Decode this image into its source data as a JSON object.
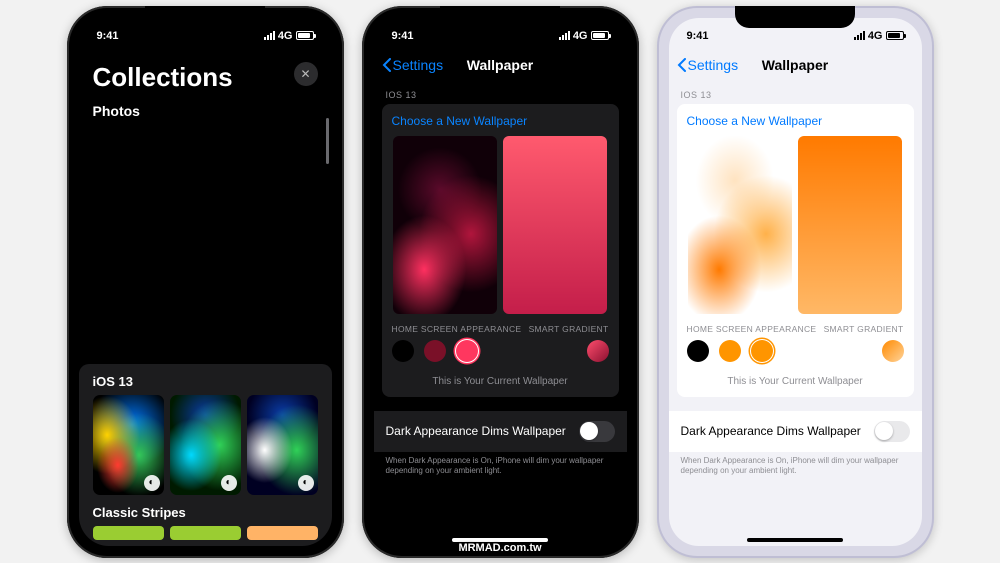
{
  "status": {
    "time": "9:41",
    "net": "4G"
  },
  "watermark": "MRMAD.com.tw",
  "phone1": {
    "title": "Collections",
    "photos_label": "Photos",
    "section_ios": "iOS 13",
    "section_stripes": "Classic Stripes"
  },
  "wallpaper": {
    "back_label": "Settings",
    "title": "Wallpaper",
    "section_header": "iOS 13",
    "choose_label": "Choose a New Wallpaper",
    "label_home": "HOME SCREEN APPEARANCE",
    "label_grad": "SMART GRADIENT",
    "current_text": "This is Your Current Wallpaper",
    "toggle_label": "Dark Appearance Dims Wallpaper",
    "footer_note": "When Dark Appearance is On, iPhone will dim your wallpaper depending on your ambient light."
  },
  "swatches_dark": [
    {
      "bg": "#000000",
      "accent": "#000000"
    },
    {
      "bg": "#7a1028",
      "accent": "#7a1028"
    },
    {
      "bg": "#ff375f",
      "accent": "#ff375f",
      "selected": true
    }
  ],
  "swatches_light": [
    {
      "bg": "#000000",
      "accent": "#000000"
    },
    {
      "bg": "#ff9500",
      "accent": "#ff9500"
    },
    {
      "bg": "#ff9500",
      "accent": "#ff9500",
      "selected": true
    }
  ]
}
